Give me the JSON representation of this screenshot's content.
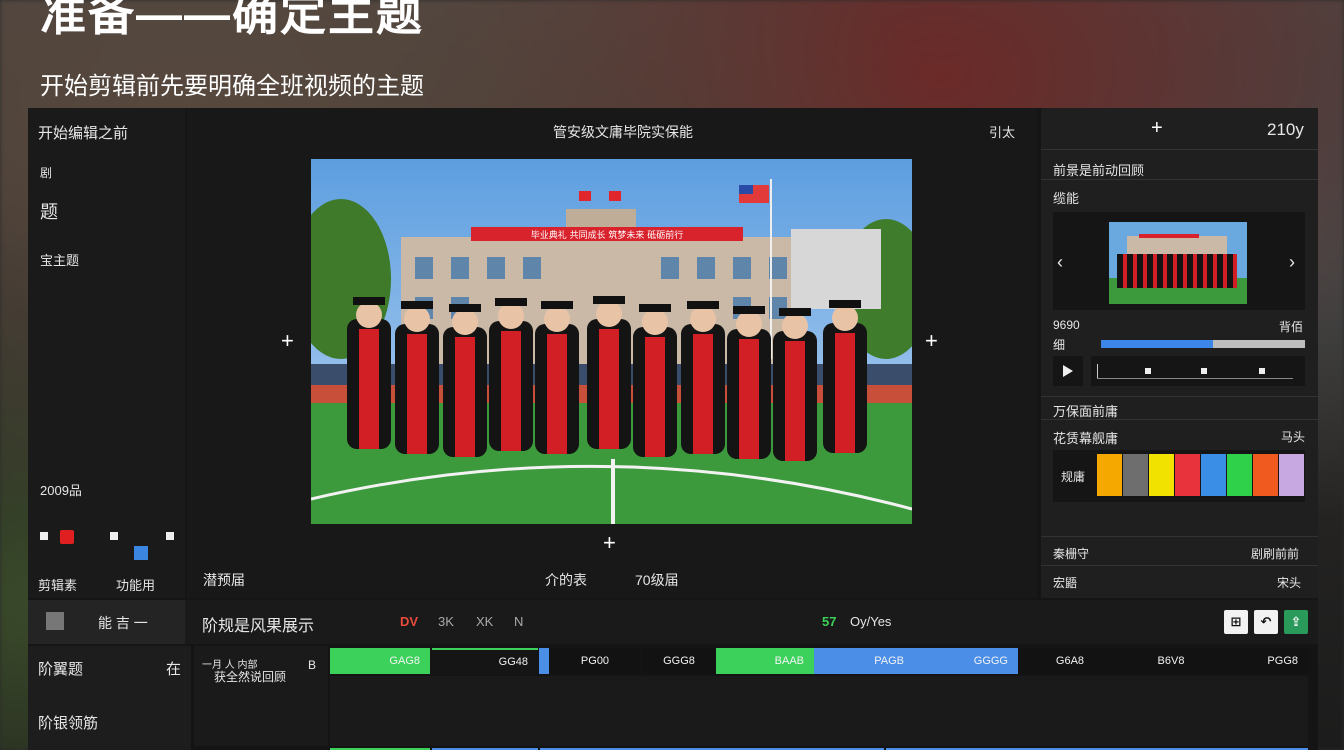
{
  "header": {
    "headline": "准备——确定主题",
    "subline": "开始剪辑前先要明确全班视频的主题"
  },
  "left_panel": {
    "title": "开始编辑之前",
    "item1": "剧",
    "item2": "题",
    "item3": "宝主题",
    "item4": "2009品",
    "label_a": "剪辑素",
    "label_b": "功能用"
  },
  "center_panel": {
    "title": "管安级文庸毕院实保能",
    "top_right": "引太",
    "banner_text": "毕业典礼 共同成长 筑梦未来 砥砺前行",
    "bottom_left": "潜预届",
    "bottom_mid": "介的表",
    "bottom_right": "70级届"
  },
  "right_panel": {
    "header_value": "210y",
    "section1_title": "前景是前动回顾",
    "section1_sub": "缆能",
    "meta_left": "9690",
    "meta_right": "背佰",
    "slider_label": "细",
    "slider_fill": 0.55,
    "section2_title": "万保面前庸",
    "section3_title": "花赁幕舰庸",
    "section3_right": "马头",
    "swatch_label": "规庸",
    "swatches": [
      "#f5a800",
      "#6e6e6e",
      "#f2e200",
      "#e8323c",
      "#3a8ee6",
      "#2fd04a",
      "#f05a1e",
      "#c8a8e0"
    ],
    "footer1_left": "秦栅守",
    "footer1_right": "剧刷前前",
    "footer2_left": "宏鼯",
    "footer2_right": "宋头"
  },
  "toolbar": {
    "left_btn_label": "能 吉 一",
    "title": "阶规是风果展示",
    "tools": [
      "DV",
      "3K",
      "XK",
      "N"
    ],
    "status_icon": "57",
    "status_text": "Oy/Yes"
  },
  "timeline": {
    "track1_label": "阶翼题",
    "track1_right": "在",
    "track2_label": "阶银领筋",
    "clip_label_left1": "一月 人 内部",
    "clip_label_left2": "获全然说回顾",
    "marker": "B",
    "row1_clips": [
      "GAG8",
      "GG48",
      "PG00",
      "GGG8",
      "BAAB",
      "PAGB",
      "GGGG",
      "G6A8",
      "B6V8",
      "PGG8"
    ]
  },
  "colors": {
    "accent_green": "#3bd15a",
    "accent_blue": "#4a8ee8",
    "gown_red": "#d21f26"
  }
}
